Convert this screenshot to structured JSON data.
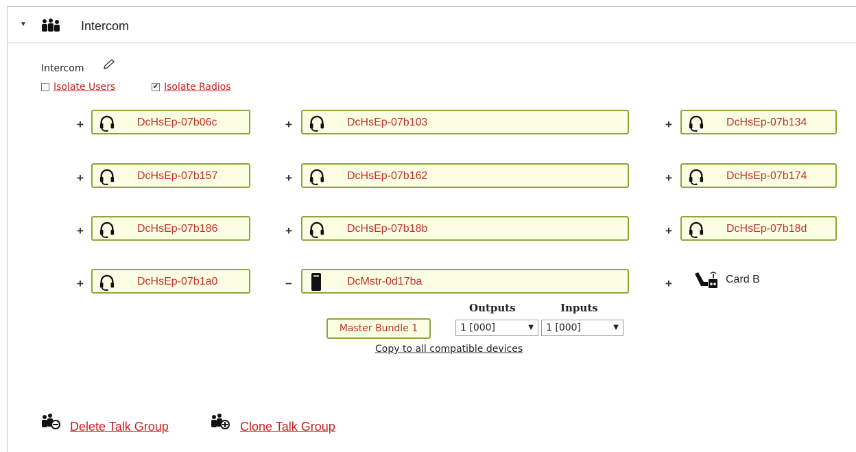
{
  "header": {
    "title": "Intercom",
    "caret_icon": "caret-down-icon",
    "group_icon": "users-group-icon"
  },
  "talk_group": {
    "name": "Intercom",
    "isolate_users": {
      "label": "Isolate Users",
      "checked": false
    },
    "isolate_radios": {
      "label": "Isolate Radios",
      "checked": true
    }
  },
  "devices": {
    "r0c0": {
      "action": "+",
      "label": "DcHsEp-07b06c",
      "icon": "headset-icon"
    },
    "r0c1": {
      "action": "+",
      "label": "DcHsEp-07b103",
      "icon": "headset-icon"
    },
    "r0c2": {
      "action": "+",
      "label": "DcHsEp-07b134",
      "icon": "headset-icon"
    },
    "r1c0": {
      "action": "+",
      "label": "DcHsEp-07b157",
      "icon": "headset-icon"
    },
    "r1c1": {
      "action": "+",
      "label": "DcHsEp-07b162",
      "icon": "headset-icon"
    },
    "r1c2": {
      "action": "+",
      "label": "DcHsEp-07b174",
      "icon": "headset-icon"
    },
    "r2c0": {
      "action": "+",
      "label": "DcHsEp-07b186",
      "icon": "headset-icon"
    },
    "r2c1": {
      "action": "+",
      "label": "DcHsEp-07b18b",
      "icon": "headset-icon"
    },
    "r2c2": {
      "action": "+",
      "label": "DcHsEp-07b18d",
      "icon": "headset-icon"
    },
    "r3c0": {
      "action": "+",
      "label": "DcHsEp-07b1a0",
      "icon": "headset-icon"
    },
    "r3c1": {
      "action": "−",
      "label": "DcMstr-0d17ba",
      "icon": "master-station-icon"
    },
    "r3c2": {
      "action": "+",
      "label": "Card B",
      "icon": "radio-card-icon"
    }
  },
  "master_config": {
    "outputs_header": "Outputs",
    "inputs_header": "Inputs",
    "bundle_label": "Master Bundle 1",
    "outputs_value": "1 [000]",
    "inputs_value": "1 [000]",
    "copy_link": "Copy to all compatible devices"
  },
  "actions": {
    "delete_label": "Delete Talk Group",
    "clone_label": "Clone Talk Group",
    "delete_icon": "delete-group-icon",
    "clone_icon": "clone-group-icon"
  },
  "colors": {
    "accent_border": "#8ca63a",
    "box_bg": "#fcfee4",
    "label_red": "#c0322b",
    "link_red": "#cc1f1f"
  }
}
